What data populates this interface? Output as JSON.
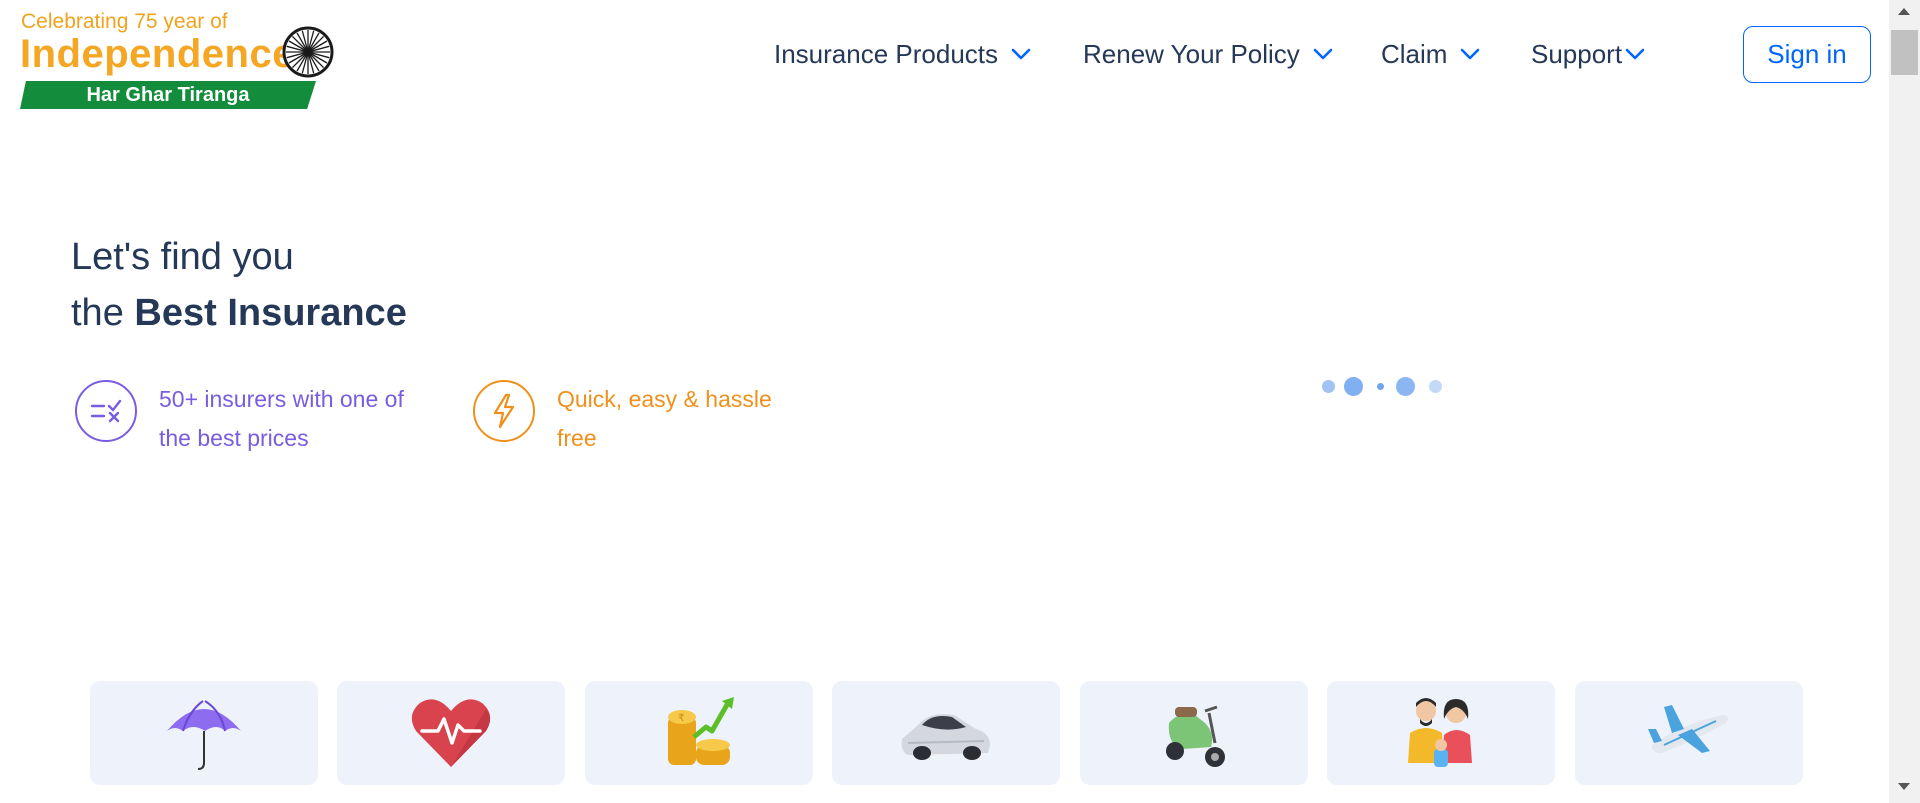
{
  "logo": {
    "tagline": "Celebrating 75 year of",
    "title": "Independence",
    "banner": "Har Ghar Tiranga",
    "emblem_icon": "ashoka-chakra-icon"
  },
  "nav": {
    "items": [
      {
        "label": "Insurance Products",
        "icon": "chevron-down-icon"
      },
      {
        "label": "Renew Your Policy",
        "icon": "chevron-down-icon"
      },
      {
        "label": "Claim",
        "icon": "chevron-down-icon"
      },
      {
        "label": "Support",
        "icon": "chevron-down-icon"
      }
    ],
    "signin_label": "Sign in"
  },
  "hero": {
    "line1": "Let's find you",
    "line2_prefix": "the",
    "line2_bold": "Best Insurance",
    "features": [
      {
        "text": "50+ insurers with one of the best prices",
        "icon": "compare-icon",
        "color": "#7a5ce0"
      },
      {
        "text": "Quick, easy & hassle free",
        "icon": "lightning-icon",
        "color": "#f0901c"
      }
    ]
  },
  "products": [
    {
      "icon": "umbrella-icon"
    },
    {
      "icon": "heart-health-icon"
    },
    {
      "icon": "coins-growth-icon"
    },
    {
      "icon": "car-icon"
    },
    {
      "icon": "scooter-icon"
    },
    {
      "icon": "family-icon"
    },
    {
      "icon": "airplane-icon"
    }
  ],
  "colors": {
    "brand_blue": "#0065ff",
    "text_dark": "#253858",
    "accent_orange": "#f5a623",
    "banner_green": "#138d3c",
    "card_bg": "#eef3fb"
  }
}
